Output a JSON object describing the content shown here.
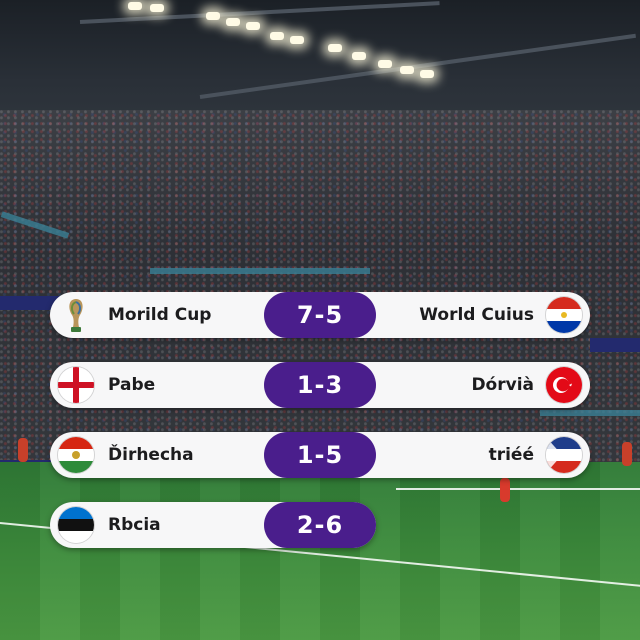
{
  "matches": [
    {
      "home": {
        "name": "Morild Cup",
        "icon": "trophy-icon"
      },
      "score": "7-5",
      "away": {
        "name": "World Cuius",
        "icon": "flag-red-white-blue-icon"
      }
    },
    {
      "home": {
        "name": "Pabe",
        "icon": "flag-red-cross-icon"
      },
      "score": "1-3",
      "away": {
        "name": "Dórvià",
        "icon": "flag-red-crescent-icon"
      }
    },
    {
      "home": {
        "name": "Ďirhecha",
        "icon": "flag-red-white-green-icon"
      },
      "score": "1-5",
      "away": {
        "name": "triéé",
        "icon": "flag-blue-white-red-icon"
      }
    },
    {
      "home": {
        "name": "Rbcia",
        "icon": "flag-blue-black-white-icon"
      },
      "score": "2-6",
      "away": null
    }
  ],
  "colors": {
    "row_background": "#f7f7f8",
    "score_pill": "#4a1e8c",
    "score_text": "#ffffff",
    "team_text": "#1c1c1e",
    "pitch": "#3d8c3c"
  }
}
